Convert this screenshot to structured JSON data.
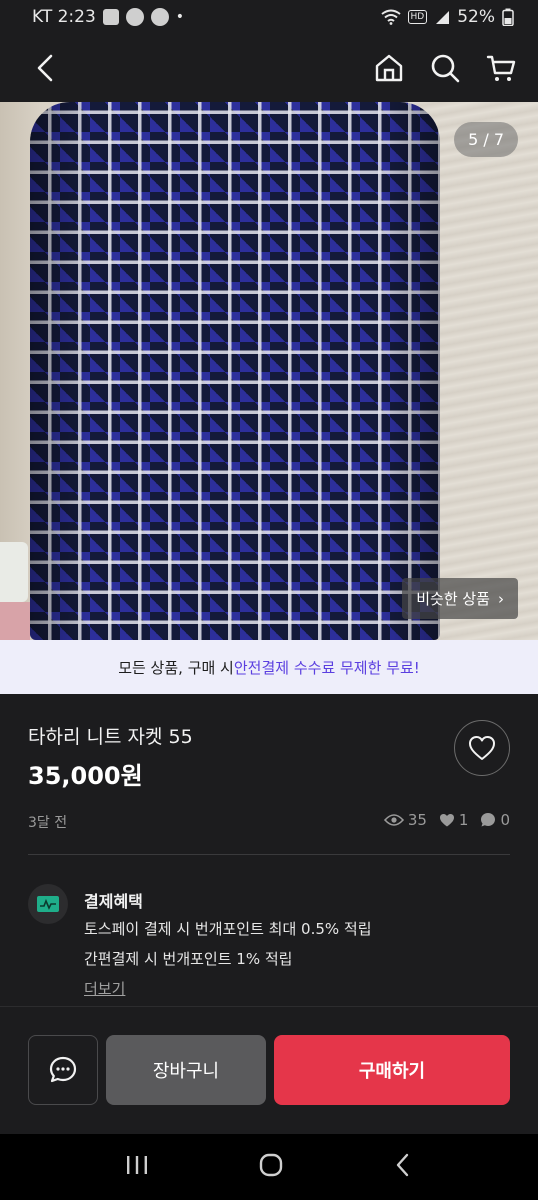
{
  "status_bar": {
    "carrier_time": "KT 2:23",
    "battery": "52%",
    "dot": "•",
    "hd": "HD",
    "icons": [
      "gallery-icon",
      "talk-icon",
      "one-icon",
      "wifi-icon",
      "signal-icon",
      "battery-icon"
    ]
  },
  "nav": {
    "icons": [
      "back-arrow-icon",
      "home-icon",
      "search-icon",
      "cart-icon"
    ]
  },
  "image": {
    "counter": "5 / 7",
    "similar_label": "비슷한 상품",
    "similar_arrow": "›"
  },
  "promo": {
    "prefix": "모든 상품, 구매 시 ",
    "highlight": "안전결제 수수료 무제한 무료!"
  },
  "product": {
    "title": "타하리 니트 자켓 55",
    "price": "35,000원",
    "time_ago": "3달 전",
    "views": "35",
    "likes": "1",
    "chats": "0"
  },
  "benefit": {
    "title": "결제혜택",
    "line1": "토스페이 결제 시 번개포인트 최대 0.5% 적립",
    "line2": "간편결제 시 번개포인트 1% 적립",
    "more": "더보기"
  },
  "actions": {
    "cart_label": "장바구니",
    "buy_label": "구매하기"
  },
  "colors": {
    "buy_button": "#e5364a",
    "promo_highlight": "#5b3fe0",
    "background": "#1c1c1e"
  }
}
